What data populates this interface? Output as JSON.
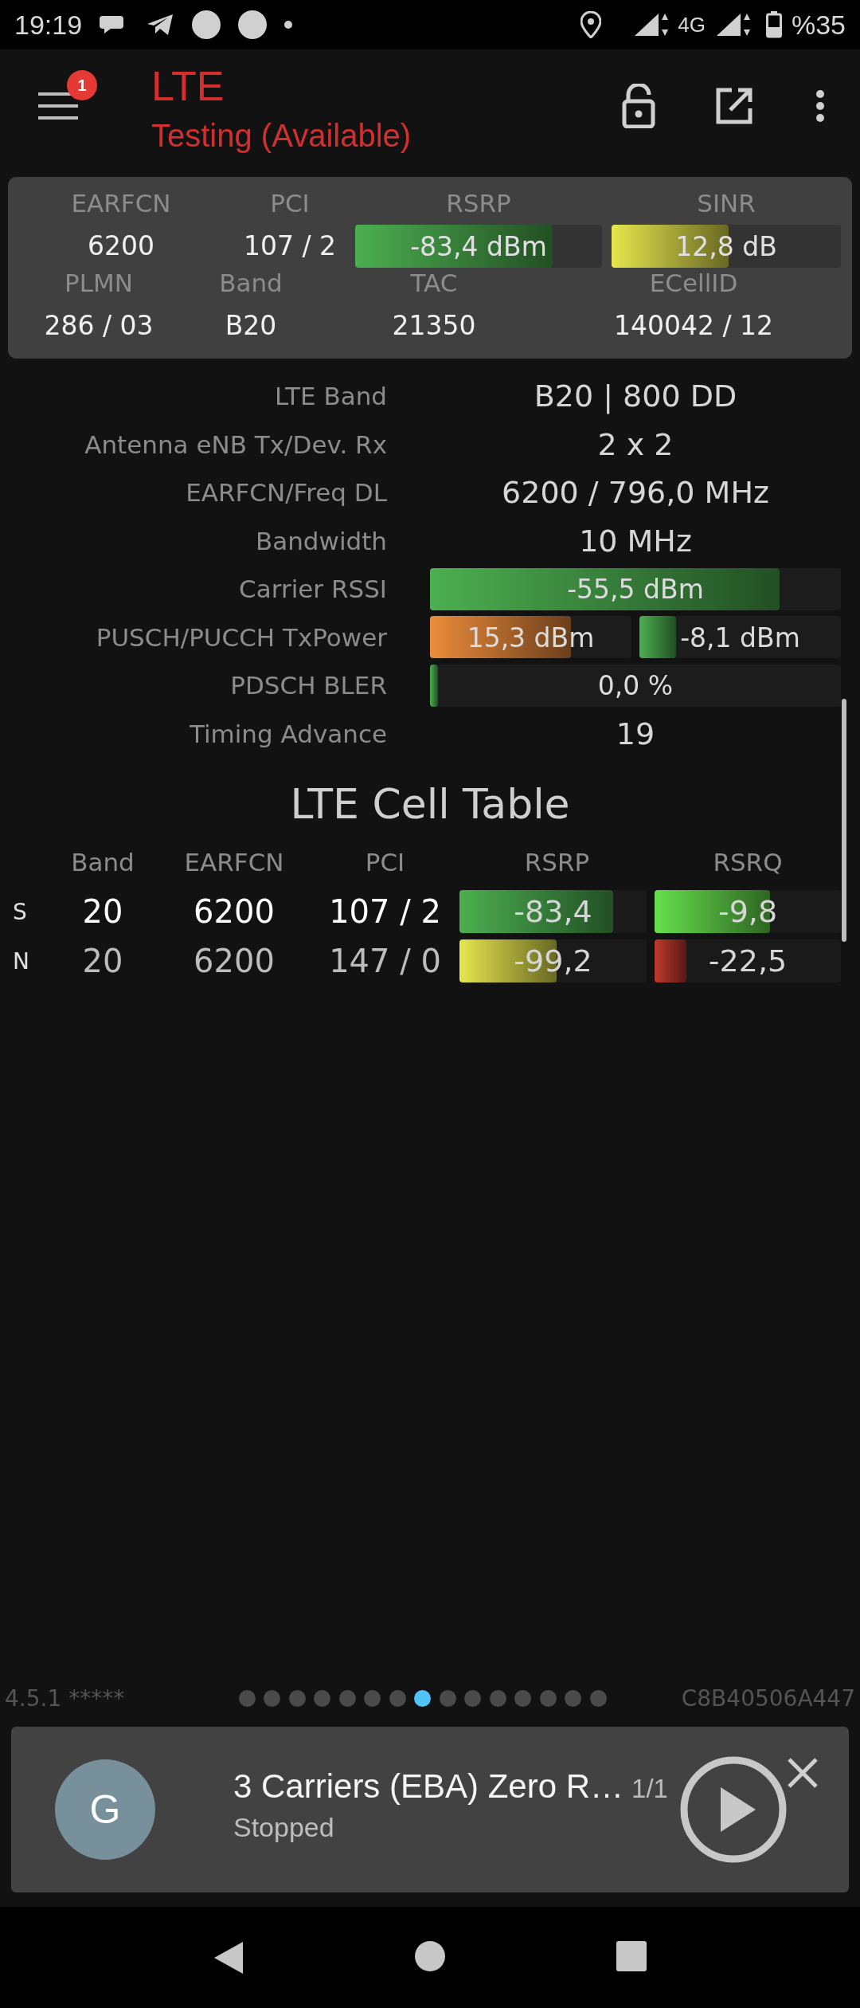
{
  "status_bar": {
    "time": "19:19",
    "network": "4G",
    "battery": "%35"
  },
  "toolbar": {
    "badge": "1",
    "title": "LTE",
    "subtitle": "Testing (Available)"
  },
  "summary": [
    {
      "cells": [
        {
          "kind": "text",
          "label": "EARFCN",
          "value": "6200"
        },
        {
          "kind": "text",
          "label": "PCI",
          "value": "107 / 2"
        },
        {
          "kind": "bar",
          "label": "RSRP",
          "value": "-83,4 dBm",
          "level": 0.8,
          "color": "#4caf50"
        },
        {
          "kind": "bar",
          "label": "SINR",
          "value": "12,8 dB",
          "level": 0.51,
          "color": "#e6e64e"
        }
      ]
    },
    {
      "cells": [
        {
          "kind": "text",
          "label": "PLMN",
          "value": "286 / 03"
        },
        {
          "kind": "text",
          "label": "Band",
          "value": "B20"
        },
        {
          "kind": "text",
          "label": "TAC",
          "value": "21350"
        },
        {
          "kind": "text",
          "label": "ECellID",
          "value": "140042 / 12"
        }
      ]
    }
  ],
  "details": [
    {
      "kind": "text",
      "label": "LTE Band",
      "value": "B20 | 800 DD"
    },
    {
      "kind": "text",
      "label": "Antenna eNB Tx/Dev. Rx",
      "value": "2 x 2"
    },
    {
      "kind": "text",
      "label": "EARFCN/Freq DL",
      "value": "6200 / 796,0 MHz"
    },
    {
      "kind": "text",
      "label": "Bandwidth",
      "value": "10 MHz"
    },
    {
      "kind": "bars",
      "label": "Carrier RSSI",
      "bars": [
        {
          "value": "-55,5 dBm",
          "level": 0.85,
          "color": "#4caf50"
        }
      ]
    },
    {
      "kind": "bars",
      "label": "PUSCH/PUCCH TxPower",
      "bars": [
        {
          "value": "15,3 dBm",
          "level": 0.7,
          "color": "#ec8c3c"
        },
        {
          "value": "-8,1 dBm",
          "level": 0.18,
          "color": "#4caf50"
        }
      ]
    },
    {
      "kind": "bars",
      "label": "PDSCH BLER",
      "bars": [
        {
          "value": "0,0 %",
          "level": 0.02,
          "color": "#4caf50"
        }
      ]
    },
    {
      "kind": "text",
      "label": "Timing Advance",
      "value": "19"
    }
  ],
  "cell_table": {
    "title": "LTE Cell Table",
    "columns": [
      "Band",
      "EARFCN",
      "PCI",
      "RSRP",
      "RSRQ"
    ],
    "rows": [
      {
        "type": "S",
        "serving": true,
        "band": "20",
        "earfcn": "6200",
        "pci": "107 / 2",
        "rsrp": {
          "value": "-83,4",
          "level": 0.82,
          "color": "#4caf50"
        },
        "rsrq": {
          "value": "-9,8",
          "level": 0.62,
          "color": "#66e04c"
        }
      },
      {
        "type": "N",
        "serving": false,
        "band": "20",
        "earfcn": "6200",
        "pci": "147 / 0",
        "rsrp": {
          "value": "-99,2",
          "level": 0.52,
          "color": "#e6e64e"
        },
        "rsrq": {
          "value": "-22,5",
          "level": 0.17,
          "color": "#c0392b"
        }
      }
    ]
  },
  "footer": {
    "version": "4.5.1 *****",
    "pages": [
      {
        "selected": false
      },
      {
        "selected": false
      },
      {
        "selected": false
      },
      {
        "selected": false
      },
      {
        "selected": false
      },
      {
        "selected": false
      },
      {
        "selected": false
      },
      {
        "selected": true
      },
      {
        "selected": false
      },
      {
        "selected": false
      },
      {
        "selected": false
      },
      {
        "selected": false
      },
      {
        "selected": false
      },
      {
        "selected": false
      },
      {
        "selected": false
      }
    ],
    "device_id": "C8B40506A447"
  },
  "player": {
    "avatar": "G",
    "title": "3 Carriers (EBA) Zero R…",
    "count": "1/1",
    "status": "Stopped"
  }
}
